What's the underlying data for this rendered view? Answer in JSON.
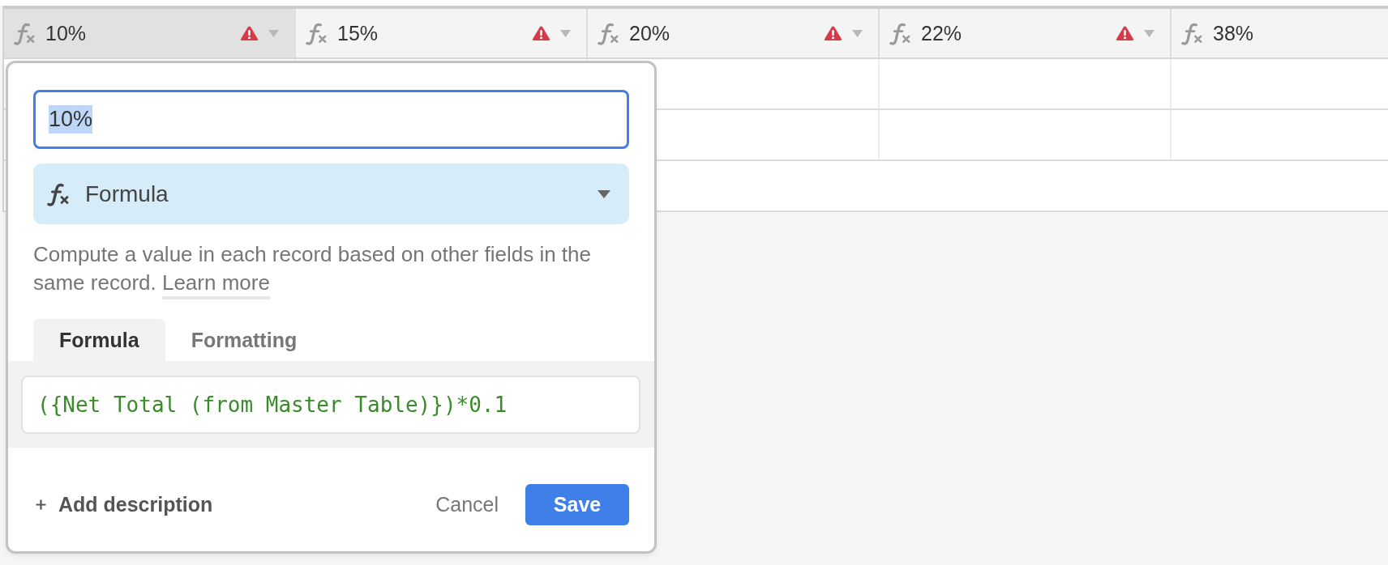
{
  "columns": [
    {
      "label": "10%",
      "selected": true,
      "warning": true,
      "caret": true
    },
    {
      "label": "15%",
      "selected": false,
      "warning": true,
      "caret": true
    },
    {
      "label": "20%",
      "selected": false,
      "warning": true,
      "caret": true
    },
    {
      "label": "22%",
      "selected": false,
      "warning": true,
      "caret": true
    },
    {
      "label": "38%",
      "selected": false
    }
  ],
  "field_editor": {
    "name": {
      "value": "10%",
      "text_selected": true
    },
    "type": {
      "label": "Formula"
    },
    "description": "Compute a value in each record based on other fields in the same record.",
    "learn_more": "Learn more",
    "tabs": [
      {
        "label": "Formula",
        "selected": true
      },
      {
        "label": "Formatting",
        "selected": false
      }
    ],
    "formula": "({Net Total (from Master Table)})*0.1",
    "add_description": "Add description",
    "cancel": "Cancel",
    "save": "Save"
  }
}
